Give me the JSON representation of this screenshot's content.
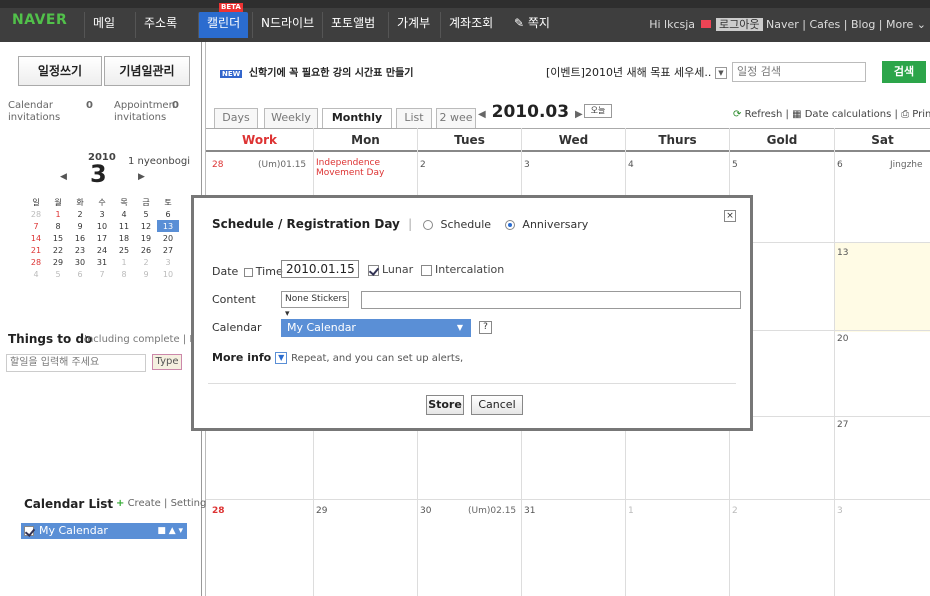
{
  "nav": {
    "logo": "NAVER",
    "tabs": [
      "메일",
      "주소록",
      "캘린더",
      "N드라이브",
      "포토앨범",
      "가계부",
      "계좌조회",
      "쪽지"
    ],
    "beta": "BETA",
    "right": {
      "greeting": "Hi lkcsja",
      "logout": "로그아웃",
      "links": "Naver | Cafes | Blog | More"
    }
  },
  "sidebar": {
    "write_btn": "일정쓰기",
    "anniv_btn": "기념일관리",
    "cal_inv": "Calendar\ninvitations",
    "cal_inv_count": "0",
    "appt_inv": "Appointmen\ninvitations",
    "appt_inv_count": "0",
    "mini_year": "2010",
    "mini_month": "3",
    "mini_label": "1 nyeonbogi",
    "weekdays": [
      "일",
      "월",
      "화",
      "수",
      "목",
      "금",
      "토"
    ],
    "weeks": [
      [
        "28",
        "1",
        "2",
        "3",
        "4",
        "5",
        "6"
      ],
      [
        "7",
        "8",
        "9",
        "10",
        "11",
        "12",
        "13"
      ],
      [
        "14",
        "15",
        "16",
        "17",
        "18",
        "19",
        "20"
      ],
      [
        "21",
        "22",
        "23",
        "24",
        "25",
        "26",
        "27"
      ],
      [
        "28",
        "29",
        "30",
        "31",
        "1",
        "2",
        "3"
      ],
      [
        "4",
        "5",
        "6",
        "7",
        "8",
        "9",
        "10"
      ]
    ],
    "things_title": "Things to do",
    "things_sub": "Including complete | Full",
    "things_placeholder": "할일을 입력해 주세요",
    "type_btn": "Type",
    "cal_list_title": "Calendar List",
    "create": "Create",
    "setting": "Setting",
    "my_calendar": "My Calendar"
  },
  "main": {
    "promo_new": "NEW",
    "promo": "신학기에 꼭 필요한 강의 시간표 만들기",
    "event": "[이벤트]2010년 새해 목표 세우세..",
    "search_placeholder": "일정 검색",
    "search_btn": "검색",
    "view_tabs": [
      "Days",
      "Weekly",
      "Monthly",
      "List",
      "2 wee"
    ],
    "month": "2010.03",
    "today_btn": "오늘",
    "refresh": "Refresh",
    "date_calc": "Date calculations",
    "print": "Print",
    "headers": [
      "Work",
      "Mon",
      "Tues",
      "Wed",
      "Thurs",
      "Gold",
      "Sat"
    ],
    "row1": [
      "28",
      "2",
      "3",
      "4",
      "5",
      "6"
    ],
    "row1_notes": {
      "lunar": "(Um)01.15",
      "holiday": "Independence\nMovement Day",
      "sat": "Jingzhe"
    },
    "row2_sat": "13",
    "row3_sat": "20",
    "row4_sat": "27",
    "row5": [
      "28",
      "29",
      "30",
      "31",
      "1",
      "2",
      "3"
    ],
    "row5_lunar": "(Um)02.15"
  },
  "modal": {
    "title": "Schedule / Registration Day",
    "opt1": "Schedule",
    "opt2": "Anniversary",
    "close": "×",
    "date_label": "Date",
    "time_label": "Time",
    "date_value": "2010.01.15",
    "lunar": "Lunar",
    "intercalation": "Intercalation",
    "content_label": "Content",
    "stickers": "None Stickers",
    "calendar_label": "Calendar",
    "calendar_value": "My Calendar",
    "help": "?",
    "more_info": "More info",
    "more_desc": "Repeat, and you can set up alerts,",
    "store": "Store",
    "cancel": "Cancel"
  }
}
